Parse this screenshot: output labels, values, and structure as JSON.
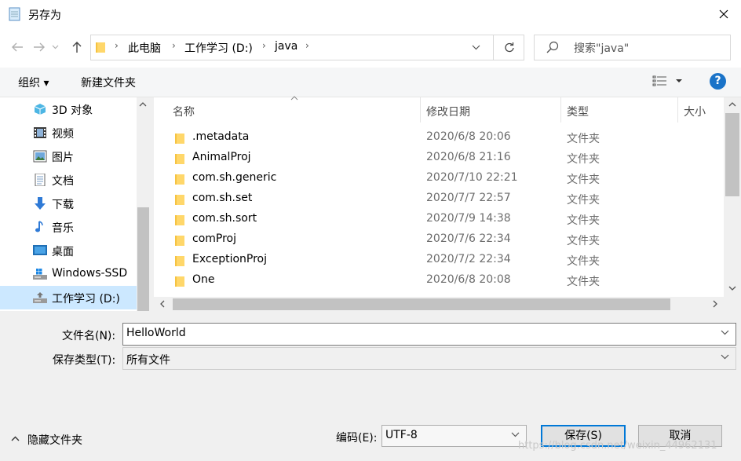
{
  "window": {
    "title": "另存为"
  },
  "address": {
    "crumbs": [
      "此电脑",
      "工作学习 (D:)",
      "java"
    ]
  },
  "search": {
    "placeholder": "搜索\"java\""
  },
  "toolbar": {
    "organize_label": "组织 ▾",
    "new_folder_label": "新建文件夹",
    "help_label": "?"
  },
  "nav": {
    "items": [
      {
        "label": "3D 对象",
        "icon": "3d-objects-icon"
      },
      {
        "label": "视频",
        "icon": "video-icon"
      },
      {
        "label": "图片",
        "icon": "pictures-icon"
      },
      {
        "label": "文档",
        "icon": "documents-icon"
      },
      {
        "label": "下载",
        "icon": "download-icon"
      },
      {
        "label": "音乐",
        "icon": "music-icon"
      },
      {
        "label": "桌面",
        "icon": "desktop-icon"
      },
      {
        "label": "Windows-SSD",
        "icon": "windows-drive-icon"
      },
      {
        "label": "工作学习 (D:)",
        "icon": "drive-icon",
        "selected": true
      }
    ]
  },
  "columns": {
    "name": "名称",
    "date": "修改日期",
    "type": "类型",
    "size": "大小"
  },
  "files": [
    {
      "name": ".metadata",
      "date": "2020/6/8 20:06",
      "type": "文件夹"
    },
    {
      "name": "AnimalProj",
      "date": "2020/6/8 21:16",
      "type": "文件夹"
    },
    {
      "name": "com.sh.generic",
      "date": "2020/7/10 22:21",
      "type": "文件夹"
    },
    {
      "name": "com.sh.set",
      "date": "2020/7/7 22:57",
      "type": "文件夹"
    },
    {
      "name": "com.sh.sort",
      "date": "2020/7/9 14:38",
      "type": "文件夹"
    },
    {
      "name": "comProj",
      "date": "2020/7/6 22:34",
      "type": "文件夹"
    },
    {
      "name": "ExceptionProj",
      "date": "2020/7/2 22:34",
      "type": "文件夹"
    },
    {
      "name": "One",
      "date": "2020/6/8 20:08",
      "type": "文件夹"
    }
  ],
  "form": {
    "filename_label": "文件名(N):",
    "filename_value": "HelloWorld",
    "filetype_label": "保存类型(T):",
    "filetype_value": "所有文件",
    "hide_folders_label": "隐藏文件夹",
    "encoding_label": "编码(E):",
    "encoding_value": "UTF-8",
    "save_label": "保存(S)",
    "cancel_label": "取消"
  },
  "watermark": "https://blog.csdn.net/weixin_44962131"
}
